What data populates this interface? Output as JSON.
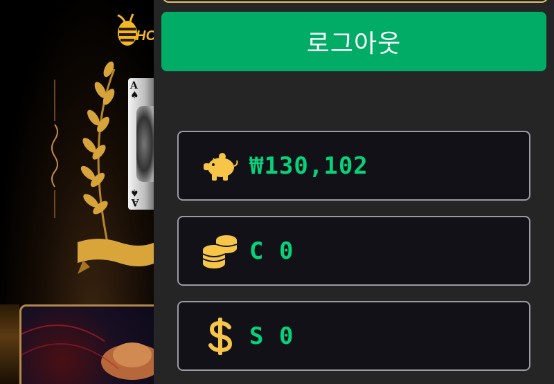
{
  "drawer": {
    "logout_label": "로그아웃",
    "accent_color": "#00ac66",
    "value_color": "#06d27a",
    "icon_color": "#f7c548"
  },
  "balances": [
    {
      "icon": "piggy-bank-icon",
      "value": "₩130,102"
    },
    {
      "icon": "coins-stack-icon",
      "value": "C 0"
    },
    {
      "icon": "dollar-sign-icon",
      "value": "S 0"
    }
  ],
  "background": {
    "logo_text": "HO"
  }
}
